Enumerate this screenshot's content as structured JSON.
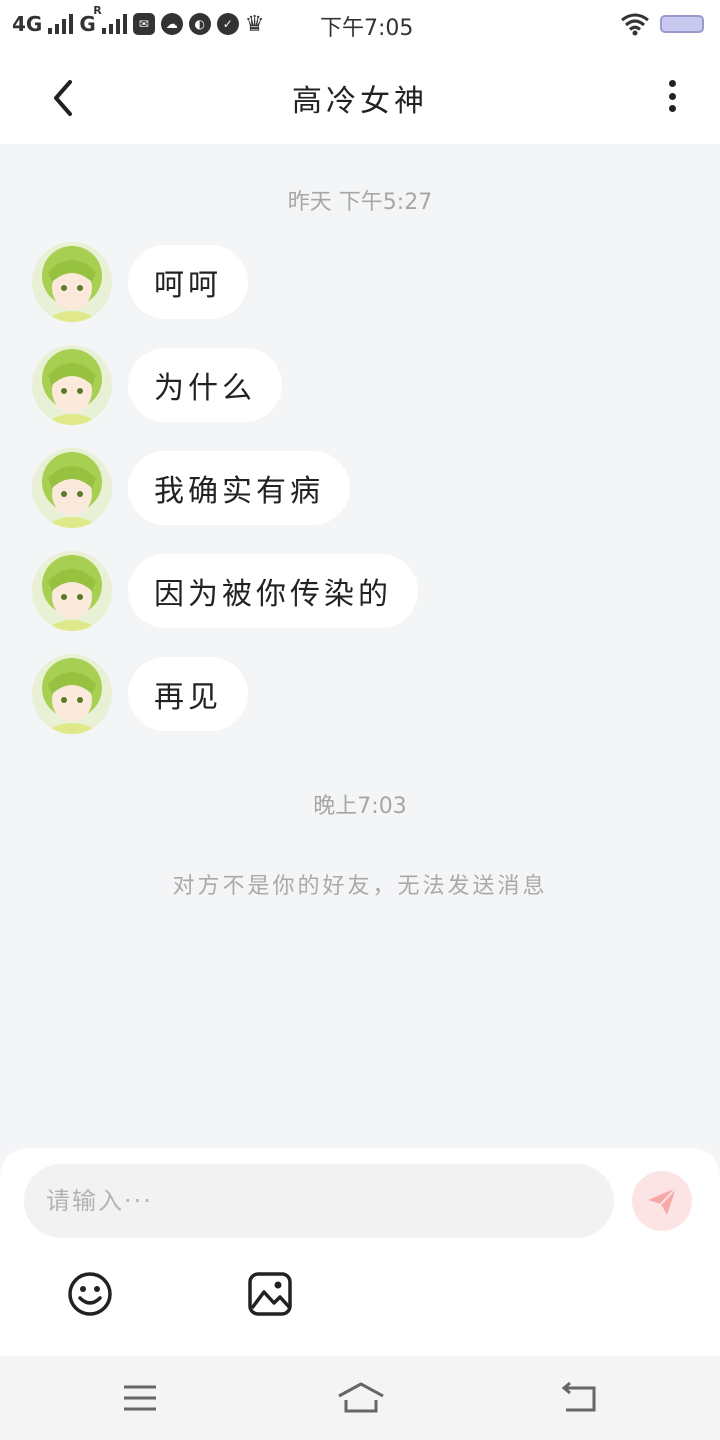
{
  "status_bar": {
    "network_1": "4G",
    "network_2": "G",
    "network_2_sup": "R",
    "time": "下午7:05",
    "icons": [
      "signal-icon",
      "signal-icon",
      "mail-icon",
      "cloud-icon",
      "app-icon",
      "check-icon",
      "crown-icon",
      "wifi-icon",
      "battery-icon"
    ]
  },
  "header": {
    "title": "高冷女神"
  },
  "chat": {
    "timestamp_1": "昨天 下午5:27",
    "messages": [
      {
        "text": "呵呵"
      },
      {
        "text": "为什么"
      },
      {
        "text": "我确实有病"
      },
      {
        "text": "因为被你传染的"
      },
      {
        "text": "再见"
      }
    ],
    "timestamp_2": "晚上7:03",
    "notice": "对方不是你的好友，无法发送消息"
  },
  "input": {
    "placeholder": "请输入···"
  },
  "colors": {
    "background": "#f4f5f7",
    "bubble": "#ffffff",
    "send_button": "#fde4e4",
    "send_icon": "#f6a9a9",
    "avatar_green": "#a7cf52"
  }
}
